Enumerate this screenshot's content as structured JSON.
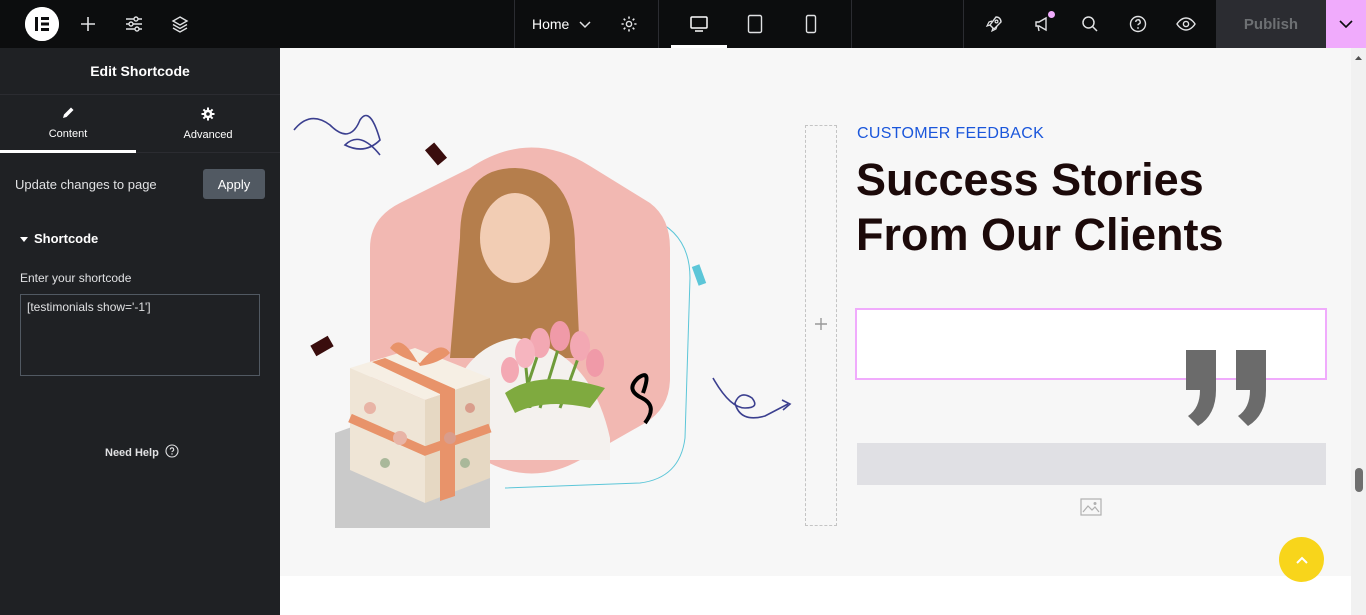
{
  "topbar": {
    "page_name": "Home",
    "publish_label": "Publish",
    "icons": [
      "elementor-logo-icon",
      "plus-icon",
      "sliders-icon",
      "layers-icon",
      "chevron-down-icon",
      "gear-icon",
      "desktop-icon",
      "tablet-icon",
      "mobile-icon",
      "rocket-icon",
      "megaphone-icon",
      "search-icon",
      "help-icon",
      "eye-icon"
    ],
    "accent": "#f0abfc"
  },
  "panel": {
    "title": "Edit Shortcode",
    "tabs": [
      {
        "label": "Content",
        "icon": "pencil-icon",
        "active": true
      },
      {
        "label": "Advanced",
        "icon": "gear-icon",
        "active": false
      }
    ],
    "update_text": "Update changes to page",
    "apply_label": "Apply",
    "section_title": "Shortcode",
    "field_label": "Enter your shortcode",
    "field_value": "[testimonials show='-1']",
    "need_help": "Need Help"
  },
  "canvas": {
    "eyebrow": "CUSTOMER FEEDBACK",
    "headline": "Success Stories From Our Clients",
    "eyebrow_color": "#1a56db",
    "scroll_top_color": "#f8d51b"
  }
}
